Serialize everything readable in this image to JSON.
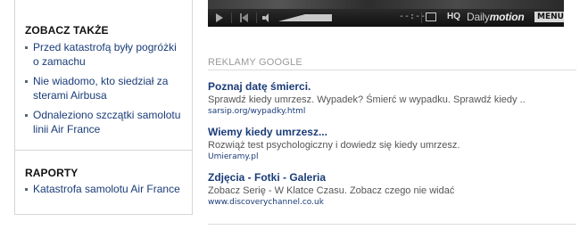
{
  "sidebar": {
    "see_also": {
      "title": "ZOBACZ TAKŻE",
      "links": [
        "Przed katastrofą były pogróżki o zamachu",
        "Nie wiadomo, kto siedział za sterami Airbusa",
        "Odnaleziono szczątki samolotu linii Air France"
      ]
    },
    "reports": {
      "title": "RAPORTY",
      "links": [
        "Katastrofa samolotu Air France"
      ]
    }
  },
  "player": {
    "time": "--:--",
    "hq_label": "HQ",
    "brand_plain": "Daily",
    "brand_italic": "motion",
    "menu_label": "MENU",
    "icons": [
      "play-icon",
      "prev-icon",
      "volume-icon",
      "fullscreen-icon"
    ]
  },
  "ads": {
    "header": "REKLAMY GOOGLE",
    "items": [
      {
        "title": "Poznaj datę śmierci.",
        "desc": "Sprawdź kiedy umrzesz. Wypadek? Śmierć w wypadku. Sprawdź kiedy ..",
        "url": "sarsip.org/wypadky.html"
      },
      {
        "title": "Wiemy kiedy umrzesz...",
        "desc": "Rozwiąż test psychologiczny i dowiedz się kiedy umrzesz.",
        "url": "Umieramy.pl"
      },
      {
        "title": "Zdjęcia - Fotki - Galeria",
        "desc": "Zobacz Serię - W Klatce Czasu. Zobacz czego nie widać",
        "url": "www.discoverychannel.co.uk"
      }
    ]
  }
}
